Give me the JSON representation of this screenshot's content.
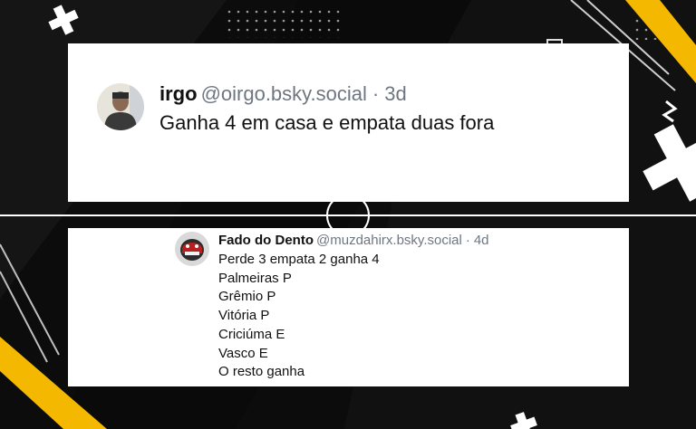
{
  "colors": {
    "background": "#0c0c0c",
    "accent_yellow": "#f5b800",
    "card": "#ffffff",
    "muted_text": "#6e7781"
  },
  "post_1": {
    "display_name": "irgo",
    "handle": "@oirgo.bsky.social",
    "separator": "·",
    "time_ago": "3d",
    "text": "Ganha 4 em casa e empata duas fora",
    "avatar_icon": "user-avatar-photo"
  },
  "post_2": {
    "display_name": "Fado do Dento",
    "handle": "@muzdahirx.bsky.social",
    "separator": "·",
    "time_ago": "4d",
    "avatar_icon": "user-avatar-photo",
    "lines": [
      "Perde 3 empata 2 ganha 4",
      "Palmeiras P",
      "Grêmio P",
      "Vitória P",
      "Criciúma E",
      "Vasco E",
      "O resto ganha"
    ]
  }
}
